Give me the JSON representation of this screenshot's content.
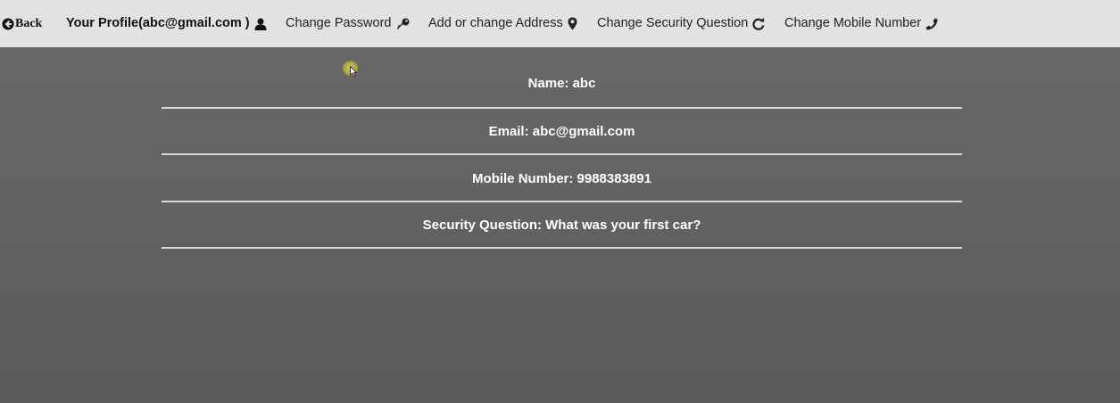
{
  "nav": {
    "back_label": "Back",
    "profile_label": "Your Profile(abc@gmail.com )",
    "change_password_label": "Change Password",
    "address_label": "Add or change Address",
    "security_question_label": "Change Security Question",
    "mobile_label": "Change Mobile Number",
    "icons": [
      "arrow-left-circle-icon",
      "user-icon",
      "key-icon",
      "map-marker-icon",
      "refresh-icon",
      "phone-icon"
    ]
  },
  "profile": {
    "name": "Name: abc",
    "email": "Email: abc@gmail.com",
    "mobile": "Mobile Number: 9988383891",
    "security_question": "Security Question: What was your first car?"
  },
  "colors": {
    "nav_bg": "#e2e2e2",
    "page_bg": "#646464",
    "text_light": "#ffffff",
    "divider": "#d8d8d8"
  }
}
